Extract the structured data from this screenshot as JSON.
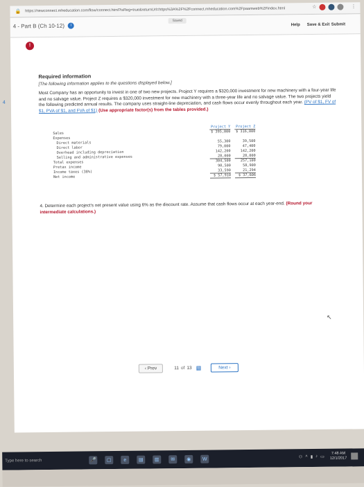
{
  "browser": {
    "url": "https://newconnect.mheducation.com/flow/connect.html?isReg=true&returnUrl=https%3A%2F%2Fconnect.mheducation.com%2Fpaamweb%2Findex.html"
  },
  "header": {
    "part_label": "4 - Part B (Ch 10-12)",
    "info_icon": "i",
    "saved_label": "Saved",
    "help": "Help",
    "save_exit": "Save & Exit",
    "submit": "Submit"
  },
  "side": {
    "badge": "!",
    "number": "4"
  },
  "content": {
    "title": "Required information",
    "subtitle": "[The following information applies to the questions displayed below.]",
    "problem_main": "Most Company has an opportunity to invest in one of two new projects. Project Y requires a $320,000 investment for new machinery with a four-year life and no salvage value. Project Z requires a $320,000 investment for new machinery with a three-year life and no salvage value. The two projects yield the following predicted annual results. The company uses straight-line depreciation, and cash flows occur evenly throughout each year.",
    "pv_links": "(PV of $1, FV of $1, PVA of $1, and FVA of $1)",
    "table_note": "(Use appropriate factor(s) from the tables provided.)",
    "question": "4. Determine each project's net present value using 6% as the discount rate. Assume that cash flows occur at each year-end.",
    "question_red": "(Round your intermediate calculations.)"
  },
  "income_table": {
    "headers": [
      "Project Y",
      "Project Z"
    ],
    "rows": [
      {
        "label": "Sales",
        "y": "$ 395,000",
        "z": "$ 316,000",
        "indent": false
      },
      {
        "label": "Expenses",
        "y": "",
        "z": "",
        "indent": false
      },
      {
        "label": "Direct materials",
        "y": "55,300",
        "z": "39,500",
        "indent": true
      },
      {
        "label": "Direct labor",
        "y": "79,000",
        "z": "47,400",
        "indent": true
      },
      {
        "label": "Overhead including depreciation",
        "y": "142,200",
        "z": "142,200",
        "indent": true
      },
      {
        "label": "Selling and administrative expenses",
        "y": "28,000",
        "z": "28,000",
        "indent": true
      },
      {
        "label": "Total expenses",
        "y": "304,500",
        "z": "257,100",
        "indent": false
      },
      {
        "label": "Pretax income",
        "y": "90,500",
        "z": "58,900",
        "indent": false
      },
      {
        "label": "Income taxes (38%)",
        "y": "33,590",
        "z": "21,294",
        "indent": false
      },
      {
        "label": "Net income",
        "y": "$ 57,910",
        "z": "$ 37,606",
        "indent": false
      }
    ]
  },
  "nav": {
    "prev": "Prev",
    "current": "11",
    "of": "of",
    "total": "13",
    "next": "Next"
  },
  "taskbar": {
    "search": "Type here to search",
    "time": "7:48 AM",
    "date": "12/1/2017"
  },
  "colors": {
    "accent": "#2d74c4",
    "alert": "#b5172d"
  }
}
